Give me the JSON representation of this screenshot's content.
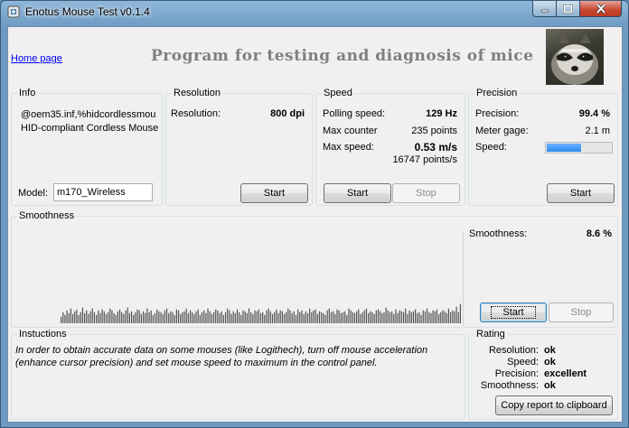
{
  "window": {
    "title": "Enotus Mouse Test v0.1.4"
  },
  "header": {
    "home_link": "Home page",
    "heading": "Program for testing and diagnosis of mice"
  },
  "info": {
    "legend": "Info",
    "device_line1": "@oem35.inf,%hidcordlessmou",
    "device_line2": "HID-compliant Cordless Mouse",
    "model_label": "Model:",
    "model_value": "m170_Wireless"
  },
  "resolution": {
    "legend": "Resolution",
    "label": "Resolution:",
    "value": "800 dpi",
    "start_label": "Start"
  },
  "speed": {
    "legend": "Speed",
    "polling_label": "Polling speed:",
    "polling_value": "129 Hz",
    "max_counter_label": "Max counter",
    "max_counter_value": "235 points",
    "max_speed_label": "Max  speed:",
    "max_speed_value": "0.53 m/s",
    "max_speed_points": "16747 points/s",
    "start_label": "Start",
    "stop_label": "Stop"
  },
  "precision": {
    "legend": "Precision",
    "precision_label": "Precision:",
    "precision_value": "99.4 %",
    "meter_label": "Meter gage:",
    "meter_value": "2.1 m",
    "speed_label": "Speed:",
    "speed_fraction": 0.55,
    "start_label": "Start"
  },
  "smoothness": {
    "legend": "Smoothness",
    "label": "Smoothness:",
    "value": "8.6 %",
    "start_label": "Start",
    "stop_label": "Stop"
  },
  "instructions": {
    "legend": "Instuctions",
    "text": "In order to obtain accurate data on some mouses (like Logithech), turn off mouse acceleration (enhance cursor precision) and set mouse speed to maximum in the control panel."
  },
  "rating": {
    "legend": "Rating",
    "resolution_label": "Resolution:",
    "resolution_value": "ok",
    "speed_label": "Speed:",
    "speed_value": "ok",
    "precision_label": "Precision:",
    "precision_value": "excellent",
    "smoothness_label": "Smoothness:",
    "smoothness_value": "ok",
    "copy_label": "Copy report to clipboard"
  },
  "chart_data": {
    "type": "bar",
    "values": [
      7,
      12,
      9,
      14,
      11,
      16,
      10,
      13,
      15,
      9,
      12,
      17,
      11,
      14,
      10,
      13,
      16,
      12,
      9,
      14,
      11,
      15,
      13,
      10,
      12,
      16,
      14,
      11,
      9,
      13,
      15,
      12,
      10,
      14,
      17,
      11,
      13,
      9,
      12,
      15,
      14,
      10,
      13,
      11,
      16,
      12,
      14,
      9,
      11,
      15,
      13,
      12,
      10,
      14,
      16,
      11,
      13,
      12,
      9,
      15,
      14,
      10,
      12,
      13,
      16,
      11,
      14,
      12,
      10,
      13,
      15,
      9,
      12,
      14,
      11,
      16,
      13,
      10,
      12,
      15,
      14,
      11,
      13,
      9,
      12,
      16,
      14,
      10,
      13,
      11,
      15,
      12,
      9,
      14,
      13,
      11,
      16,
      12,
      10,
      14,
      13,
      15,
      11,
      12,
      9,
      14,
      16,
      13,
      10,
      12,
      15,
      11,
      14,
      13,
      10,
      12,
      16,
      14,
      11,
      13,
      9,
      15,
      12,
      14,
      10,
      13,
      11,
      16,
      12,
      14,
      15,
      10,
      13,
      12,
      11,
      9,
      14,
      16,
      12,
      13,
      10,
      15,
      14,
      11,
      12,
      13,
      9,
      16,
      14,
      12,
      11,
      13,
      15,
      10,
      12,
      14,
      16,
      11,
      13,
      12,
      10,
      14,
      15,
      13,
      11,
      12,
      17,
      14,
      12,
      13,
      10,
      15,
      11,
      14,
      13,
      12,
      16,
      10,
      14,
      12,
      13,
      15,
      11,
      12,
      9,
      14,
      13,
      16,
      12,
      11,
      14,
      13,
      15,
      10,
      12,
      14,
      13,
      11,
      16,
      12,
      14,
      13,
      18,
      12,
      21
    ],
    "ylim": [
      0,
      100
    ]
  }
}
